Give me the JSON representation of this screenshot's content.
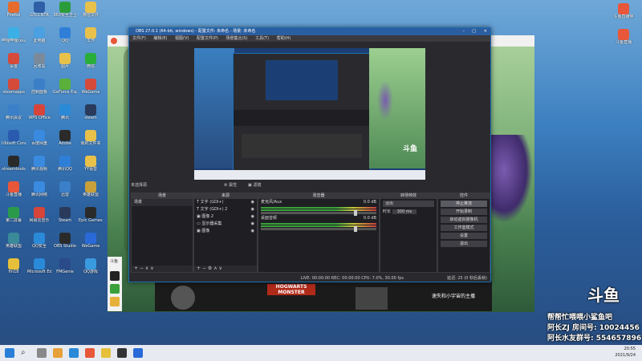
{
  "desktop": {
    "icons": [
      {
        "label": "Firefox",
        "color": "#e66b2c"
      },
      {
        "label": "GTCCNTR",
        "color": "#2f5fa6"
      },
      {
        "label": "360安全卫士",
        "color": "#2a9d3a"
      },
      {
        "label": "微信文件",
        "color": "#e8c14a"
      },
      {
        "label": "哔哩哔哩(xsuper)",
        "color": "#3bb0e6"
      },
      {
        "label": "此电脑",
        "color": "#4aa0e0"
      },
      {
        "label": "QQ",
        "color": "#2f7fd8"
      },
      {
        "label": "工作",
        "color": "#e8c14a"
      },
      {
        "label": "设置",
        "color": "#d64a3a"
      },
      {
        "label": "回收站",
        "color": "#7a8a9a"
      },
      {
        "label": "图片",
        "color": "#e8c14a"
      },
      {
        "label": "微信",
        "color": "#2aae3a"
      },
      {
        "label": "steamapps",
        "color": "#d64a3a"
      },
      {
        "label": "控制面板",
        "color": "#3a7fc8"
      },
      {
        "label": "GeForce Experience",
        "color": "#5ab03a"
      },
      {
        "label": "WeGame",
        "color": "#d64a3a"
      },
      {
        "label": "腾讯会议",
        "color": "#3a7fc8"
      },
      {
        "label": "WPS Office",
        "color": "#d6443a"
      },
      {
        "label": "腾讯",
        "color": "#2a8ad8"
      },
      {
        "label": "steam",
        "color": "#2a3a5a"
      },
      {
        "label": "Ubisoft Connect",
        "color": "#2a5ab0"
      },
      {
        "label": "百度网盘",
        "color": "#3a8ae0"
      },
      {
        "label": "Adobe",
        "color": "#2a2a2a"
      },
      {
        "label": "我的文件夹",
        "color": "#e8c14a"
      },
      {
        "label": "streamtools",
        "color": "#2a2a2a"
      },
      {
        "label": "腾讯视频",
        "color": "#3a8ae0"
      },
      {
        "label": "腾讯QQ",
        "color": "#2f7fd8"
      },
      {
        "label": "YY语音",
        "color": "#e8c14a"
      },
      {
        "label": "斗鱼直播",
        "color": "#e8573a"
      },
      {
        "label": "腾讯网络",
        "color": "#3a8ae0"
      },
      {
        "label": "迅雷",
        "color": "#3a7fc8"
      },
      {
        "label": "英雄联盟",
        "color": "#c8a03a"
      },
      {
        "label": "第二屏幕",
        "color": "#2a9a4a"
      },
      {
        "label": "网易云音乐",
        "color": "#d6443a"
      },
      {
        "label": "Steam",
        "color": "#2a3a5a"
      },
      {
        "label": "Epic Games Launcher",
        "color": "#2a2a2a"
      },
      {
        "label": "英雄联盟",
        "color": "#3a8a9a"
      },
      {
        "label": "QQ安全",
        "color": "#2a8ad8"
      },
      {
        "label": "OBS Studio",
        "color": "#2a2a2a"
      },
      {
        "label": "WeGame",
        "color": "#2a6ad8"
      },
      {
        "label": "fm18",
        "color": "#e6c03a"
      },
      {
        "label": "Microsoft Edge",
        "color": "#2a8ad8"
      },
      {
        "label": "FMGenie",
        "color": "#2a4a8a"
      },
      {
        "label": "QQ游戏",
        "color": "#3a9ae0"
      }
    ],
    "right_icons": [
      {
        "label": "斗鱼直播伴",
        "color": "#e8573a"
      },
      {
        "label": "斗鱼直播",
        "color": "#e8573a"
      }
    ]
  },
  "obs": {
    "title": "OBS 27.0.1 (64-bit, windows) - 配置文件: 未命名 - 场景: 未命名",
    "menu": [
      "文件(F)",
      "编辑(E)",
      "视图(V)",
      "配置文件(P)",
      "场景集合(S)",
      "工具(T)",
      "帮助(H)"
    ],
    "preview_label": "未选择源",
    "panels": {
      "scenes": {
        "title": "场景",
        "items": [
          "场景"
        ]
      },
      "sources": {
        "title": "来源",
        "items": [
          "文字 (GDI+)",
          "文字 (GDI+) 2",
          "图像 2",
          "显示器采集",
          "图像"
        ]
      },
      "mixer": {
        "title": "混音器",
        "channels": [
          {
            "name": "麦克风/Aux",
            "db": "0.0 dB"
          },
          {
            "name": "桌面音频",
            "db": "0.0 dB"
          }
        ]
      },
      "transitions": {
        "title": "转场特效",
        "type": "淡出",
        "duration_label": "时长",
        "duration": "300 ms"
      },
      "controls": {
        "title": "控件",
        "buttons": [
          "停止推流",
          "开始录制",
          "启动虚拟摄像机",
          "工作室模式",
          "设置",
          "退出"
        ]
      }
    },
    "status": "LIVE: 00:00:00   REC: 00:00:00   CPU: 7.0%, 30.00 fps",
    "status_right": "延迟: 25 (0 秒后丢帧)"
  },
  "game": {
    "title": "HOGWARTS MONSTER",
    "caption": "速失和小宇宙的主播"
  },
  "overlay": {
    "brand": "斗鱼",
    "line1": "帮帮忙喂喂小鲨鱼吧",
    "line2": "阿长ZJ   房间号: 10024456",
    "line3": "阿长水友群号: 554657896"
  },
  "taskbar": {
    "time": "20:55",
    "date": "2021/9/24"
  }
}
